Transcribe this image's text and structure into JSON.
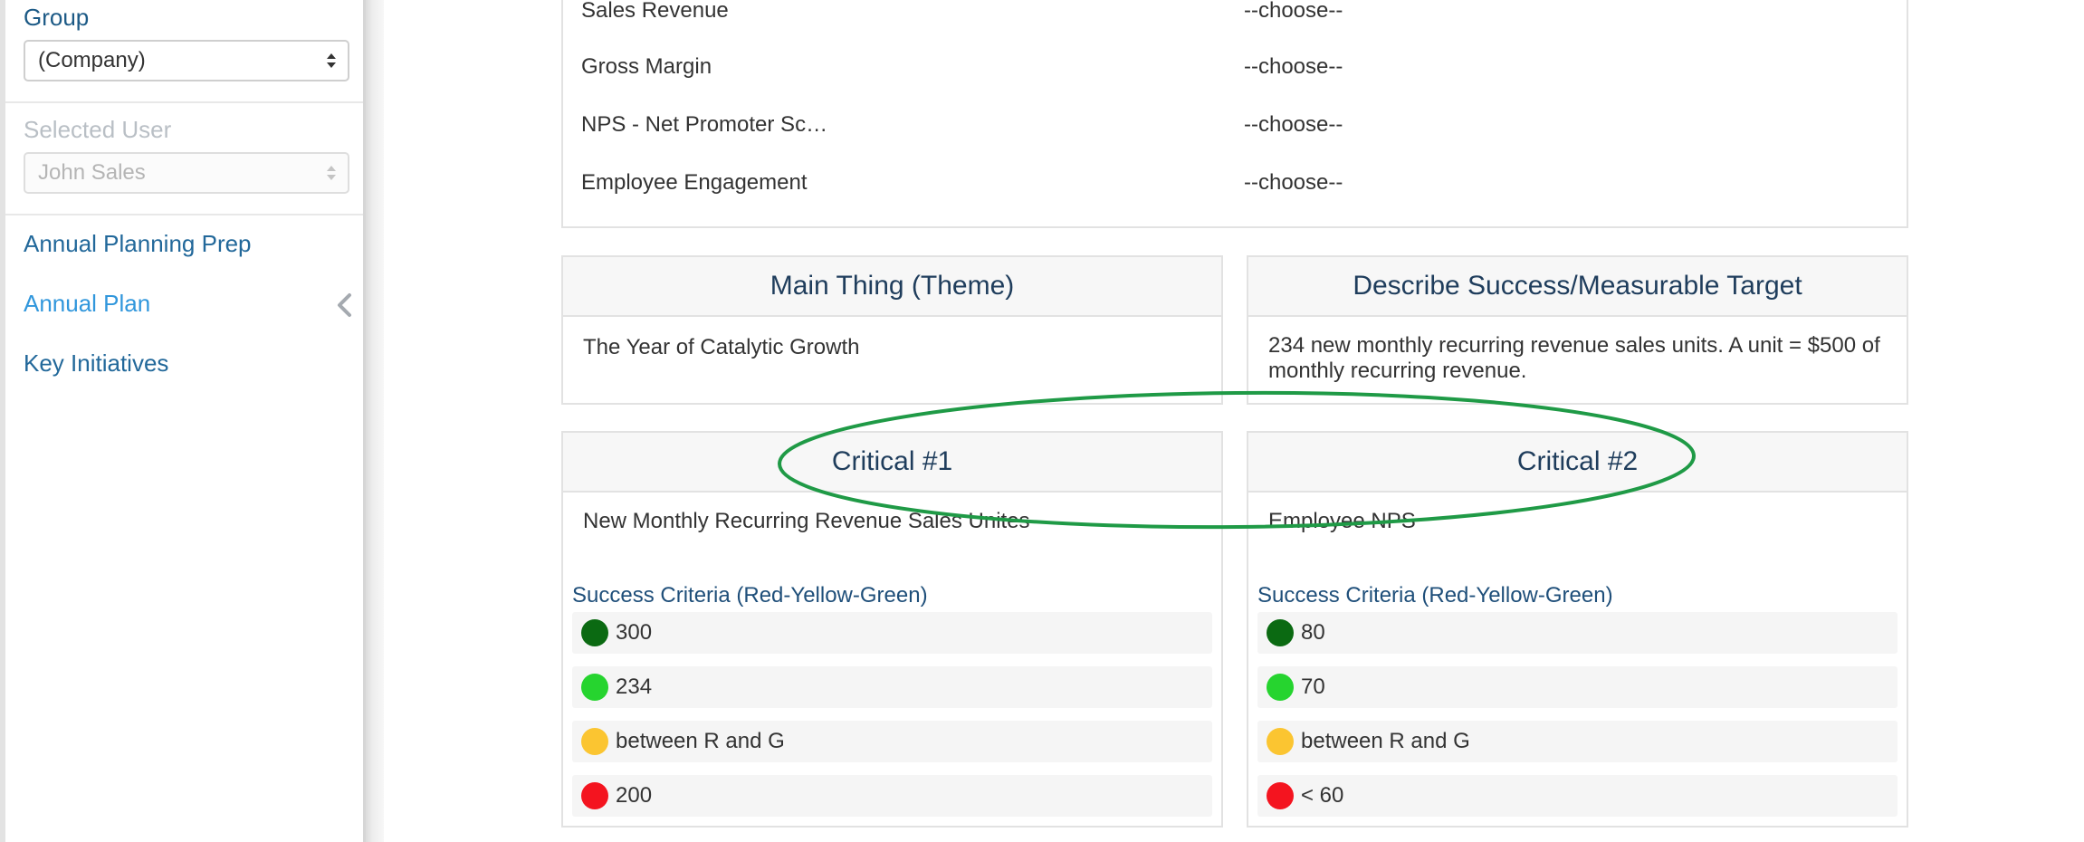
{
  "sidebar": {
    "group_label": "Group",
    "group_value": "(Company)",
    "selected_user_label": "Selected User",
    "selected_user_value": "John Sales",
    "nav": [
      {
        "label": "Annual Planning Prep"
      },
      {
        "label": "Annual Plan"
      },
      {
        "label": "Key Initiatives"
      }
    ]
  },
  "kpis": [
    {
      "label": "Sales Revenue",
      "value": "--choose--"
    },
    {
      "label": "Gross Margin",
      "value": "--choose--"
    },
    {
      "label": "NPS - Net Promoter Sc…",
      "value": "--choose--"
    },
    {
      "label": "Employee Engagement",
      "value": "--choose--"
    }
  ],
  "main_thing": {
    "title": "Main Thing (Theme)",
    "body": "The Year of Catalytic Growth"
  },
  "success_target": {
    "title": "Describe Success/Measurable Target",
    "body_line1": "234 new monthly recurring revenue sales units. A unit = $500 of",
    "body_line2": "monthly recurring revenue."
  },
  "critical": [
    {
      "title": "Critical #1",
      "body": "New Monthly Recurring Revenue Sales Unites",
      "criteria_label": "Success Criteria (Red-Yellow-Green)",
      "criteria": [
        {
          "value": "300",
          "color": "#0b6a12"
        },
        {
          "value": "234",
          "color": "#26d42f"
        },
        {
          "value": "between R and G",
          "color": "#fbc531"
        },
        {
          "value": "200",
          "color": "#f4141f"
        }
      ]
    },
    {
      "title": "Critical #2",
      "body": "Employee NPS",
      "criteria_label": "Success Criteria (Red-Yellow-Green)",
      "criteria": [
        {
          "value": "80",
          "color": "#0b6a12"
        },
        {
          "value": "70",
          "color": "#26d42f"
        },
        {
          "value": "between R and G",
          "color": "#fbc531"
        },
        {
          "value": "< 60",
          "color": "#f4141f"
        }
      ]
    }
  ],
  "colors": {
    "link": "#22689a",
    "link_active": "#3197dc",
    "heading": "#1f3d5c",
    "annotation": "#1f9a46"
  },
  "icons": {
    "select_arrows": "up-down-arrows-icon",
    "nav_expand": "chevron-left-icon"
  }
}
